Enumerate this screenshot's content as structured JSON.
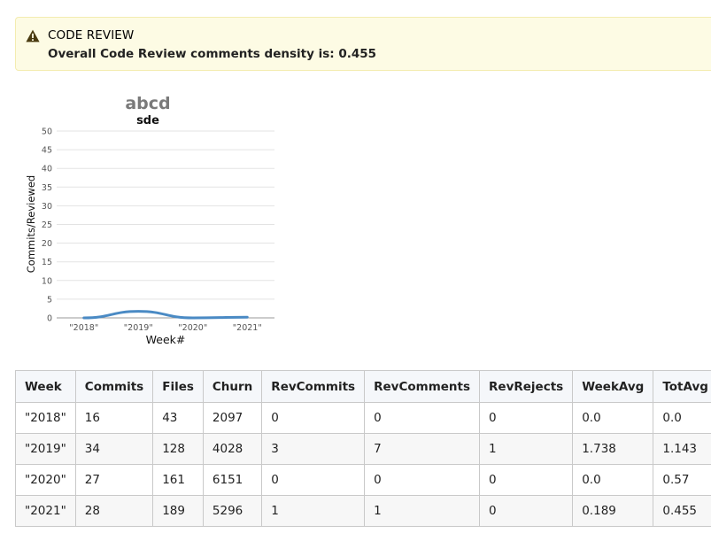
{
  "alert": {
    "icon": "warning-triangle-icon",
    "title": "CODE REVIEW",
    "message_prefix": "Overall Code Review comments density is: ",
    "message_value": "0.455"
  },
  "chart_data": {
    "type": "line",
    "title": "abcd",
    "subtitle": "sde",
    "xlabel": "Week#",
    "ylabel": "Commits/Reviewed",
    "categories": [
      "\"2018\"",
      "\"2019\"",
      "\"2020\"",
      "\"2021\""
    ],
    "series": [
      {
        "values": [
          0,
          1.738,
          0,
          0.189
        ]
      }
    ],
    "ylim": [
      0,
      50
    ],
    "yticks": [
      0,
      5,
      10,
      15,
      20,
      25,
      30,
      35,
      40,
      45,
      50
    ],
    "grid": true,
    "line_color": "#4a8ac4"
  },
  "table": {
    "headers": [
      "Week",
      "Commits",
      "Files",
      "Churn",
      "RevCommits",
      "RevComments",
      "RevRejects",
      "WeekAvg",
      "TotAvg"
    ],
    "rows": [
      [
        "\"2018\"",
        "16",
        "43",
        "2097",
        "0",
        "0",
        "0",
        "0.0",
        "0.0"
      ],
      [
        "\"2019\"",
        "34",
        "128",
        "4028",
        "3",
        "7",
        "1",
        "1.738",
        "1.143"
      ],
      [
        "\"2020\"",
        "27",
        "161",
        "6151",
        "0",
        "0",
        "0",
        "0.0",
        "0.57"
      ],
      [
        "\"2021\"",
        "28",
        "189",
        "5296",
        "1",
        "1",
        "0",
        "0.189",
        "0.455"
      ]
    ]
  }
}
